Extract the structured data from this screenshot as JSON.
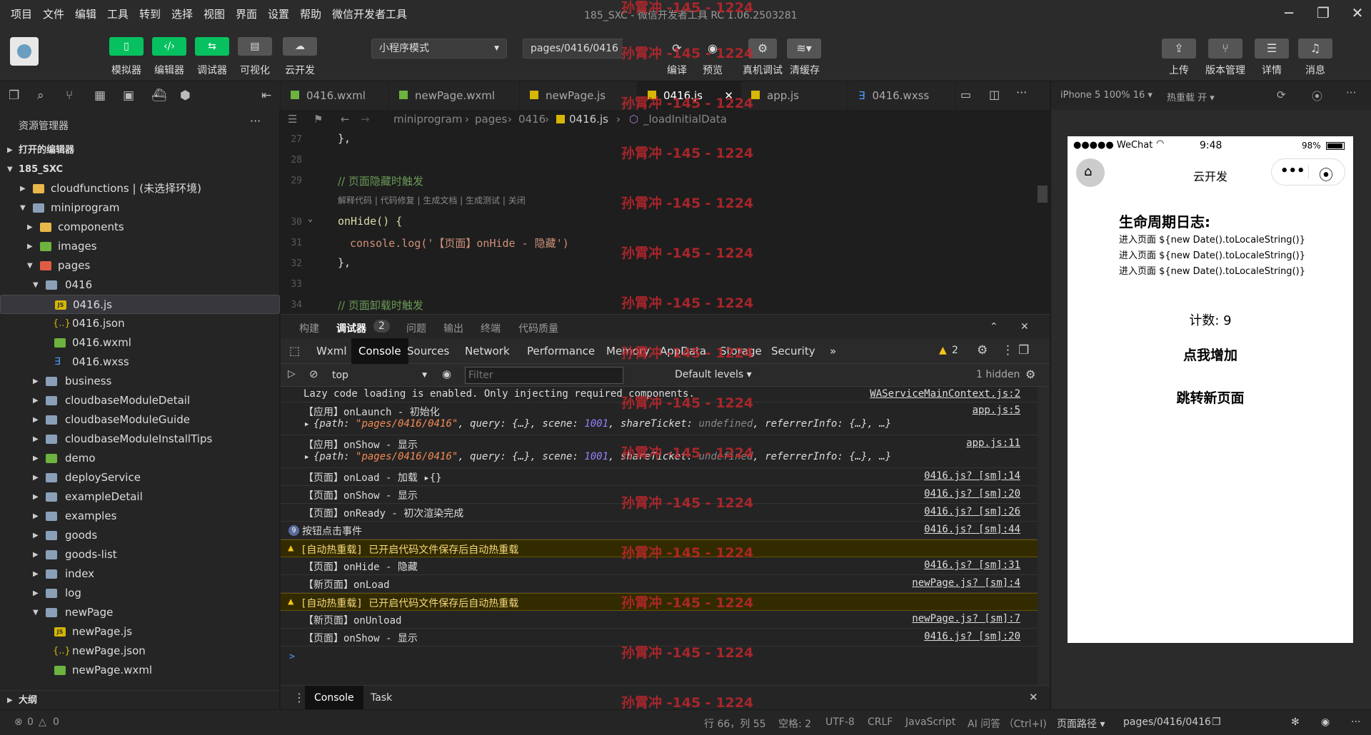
{
  "menu": {
    "items": [
      "项目",
      "文件",
      "编辑",
      "工具",
      "转到",
      "选择",
      "视图",
      "界面",
      "设置",
      "帮助",
      "微信开发者工具"
    ]
  },
  "window": {
    "title": "185_SXC - 微信开发者工具 RC 1.06.2503281"
  },
  "toolbar": {
    "buttons": [
      "模拟器",
      "编辑器",
      "调试器",
      "可视化",
      "云开发"
    ],
    "mode_select": "小程序模式",
    "page_select": "pages/0416/0416",
    "actions": [
      "编译",
      "预览",
      "真机调试",
      "清缓存"
    ],
    "right": [
      "上传",
      "版本管理",
      "详情",
      "消息"
    ]
  },
  "explorer": {
    "title": "资源管理器",
    "sections": {
      "open_editors": "打开的编辑器",
      "project": "185_SXC",
      "outline": "大纲"
    },
    "items": [
      {
        "label": "cloudfunctions | (未选择环境)"
      },
      {
        "label": "miniprogram"
      },
      {
        "label": "components"
      },
      {
        "label": "images"
      },
      {
        "label": "pages"
      },
      {
        "label": "0416"
      },
      {
        "label": "0416.js"
      },
      {
        "label": "0416.json"
      },
      {
        "label": "0416.wxml"
      },
      {
        "label": "0416.wxss"
      },
      {
        "label": "business"
      },
      {
        "label": "cloudbaseModuleDetail"
      },
      {
        "label": "cloudbaseModuleGuide"
      },
      {
        "label": "cloudbaseModuleInstallTips"
      },
      {
        "label": "demo"
      },
      {
        "label": "deployService"
      },
      {
        "label": "exampleDetail"
      },
      {
        "label": "examples"
      },
      {
        "label": "goods"
      },
      {
        "label": "goods-list"
      },
      {
        "label": "index"
      },
      {
        "label": "log"
      },
      {
        "label": "newPage"
      },
      {
        "label": "newPage.js"
      },
      {
        "label": "newPage.json"
      },
      {
        "label": "newPage.wxml"
      }
    ]
  },
  "editor": {
    "tabs": [
      "0416.wxml",
      "newPage.wxml",
      "newPage.js",
      "0416.js",
      "app.js",
      "0416.wxss"
    ],
    "breadcrumb": [
      "miniprogram",
      "pages",
      "0416",
      "0416.js",
      "_loadInitialData"
    ],
    "lines": [
      {
        "n": "27",
        "text": "},"
      },
      {
        "n": "28",
        "text": ""
      },
      {
        "n": "29",
        "text": "// 页面隐藏时触发"
      },
      {
        "n": "",
        "text": "解释代码 | 代码修复 | 生成文档 | 生成测试 | 关闭"
      },
      {
        "n": "30",
        "text": "onHide() {"
      },
      {
        "n": "31",
        "text_a": "console.log('【页面】onHide - 隐藏')"
      },
      {
        "n": "32",
        "text": "},"
      },
      {
        "n": "33",
        "text": ""
      },
      {
        "n": "34",
        "text": "// 页面卸载时触发"
      }
    ]
  },
  "panel": {
    "tabs": [
      "构建",
      "调试器",
      "问题",
      "输出",
      "终端",
      "代码质量"
    ],
    "badge": "2",
    "devtabs": [
      "Wxml",
      "Console",
      "Sources",
      "Network",
      "Performance",
      "Memory",
      "AppData",
      "Storage",
      "Security"
    ],
    "more": "»",
    "warn_count": "2",
    "context": "top",
    "filter_placeholder": "Filter",
    "levels": "Default levels ▾",
    "hidden": "1 hidden",
    "prompt": ">"
  },
  "console": [
    {
      "text": "Lazy code loading is enabled. Only injecting required components.",
      "src": "WAServiceMainContext.js:2"
    },
    {
      "text": "【应用】onLaunch - 初始化",
      "src": "app.js:5"
    },
    {
      "text": "【应用】onShow - 显示",
      "src": "app.js:11"
    },
    {
      "text": "【页面】onLoad - 加载 ▸{}",
      "src": "0416.js? [sm]:14"
    },
    {
      "text": "【页面】onShow - 显示",
      "src": "0416.js? [sm]:20"
    },
    {
      "text": "【页面】onReady - 初次渲染完成",
      "src": "0416.js? [sm]:26"
    },
    {
      "text": "按钮点击事件",
      "src": "0416.js? [sm]:44",
      "count": "9"
    },
    {
      "text": "[自动热重载] 已开启代码文件保存后自动热重载",
      "src": ""
    },
    {
      "text": "【页面】onHide - 隐藏",
      "src": "0416.js? [sm]:31"
    },
    {
      "text": "【新页面】onLoad",
      "src": "newPage.js? [sm]:4"
    },
    {
      "text": "[自动热重载] 已开启代码文件保存后自动热重载",
      "src": ""
    },
    {
      "text": "【新页面】onUnload",
      "src": "newPage.js? [sm]:7"
    },
    {
      "text": "【页面】onShow - 显示",
      "src": "0416.js? [sm]:20"
    }
  ],
  "console_obj": {
    "a": "{path: ",
    "path": "\"pages/0416/0416\"",
    "b": ", query: {…}, scene: ",
    "scene": "1001",
    "c": ", shareTicket: ",
    "und": "undefined",
    "d": ", referrerInfo: {…}, …}"
  },
  "drawer": {
    "tabs": [
      "Console",
      "Task"
    ]
  },
  "simulator": {
    "device": "iPhone 5 100% 16 ▾",
    "hotreload": "热重载 开 ▾",
    "carrier": "●●●●● WeChat",
    "time": "9:48",
    "battery": "98%",
    "nav_title": "云开发",
    "log_title": "生命周期日志:",
    "log_lines": [
      "进入页面 ${new Date().toLocaleString()}",
      "进入页面 ${new Date().toLocaleString()}",
      "进入页面 ${new Date().toLocaleString()}"
    ],
    "count": "计数: 9",
    "btn_add": "点我增加",
    "btn_nav": "跳转新页面"
  },
  "status": {
    "errors": "0",
    "warnings": "0",
    "position": "行 66，列 55",
    "spaces": "空格: 2",
    "encoding": "UTF-8",
    "eol": "CRLF",
    "lang": "JavaScript",
    "ai": "AI 问答 （Ctrl+I)",
    "page_path_label": "页面路径 ▾",
    "page_path": "pages/0416/0416"
  },
  "watermark": "孙霄冲 -145 - 1224"
}
